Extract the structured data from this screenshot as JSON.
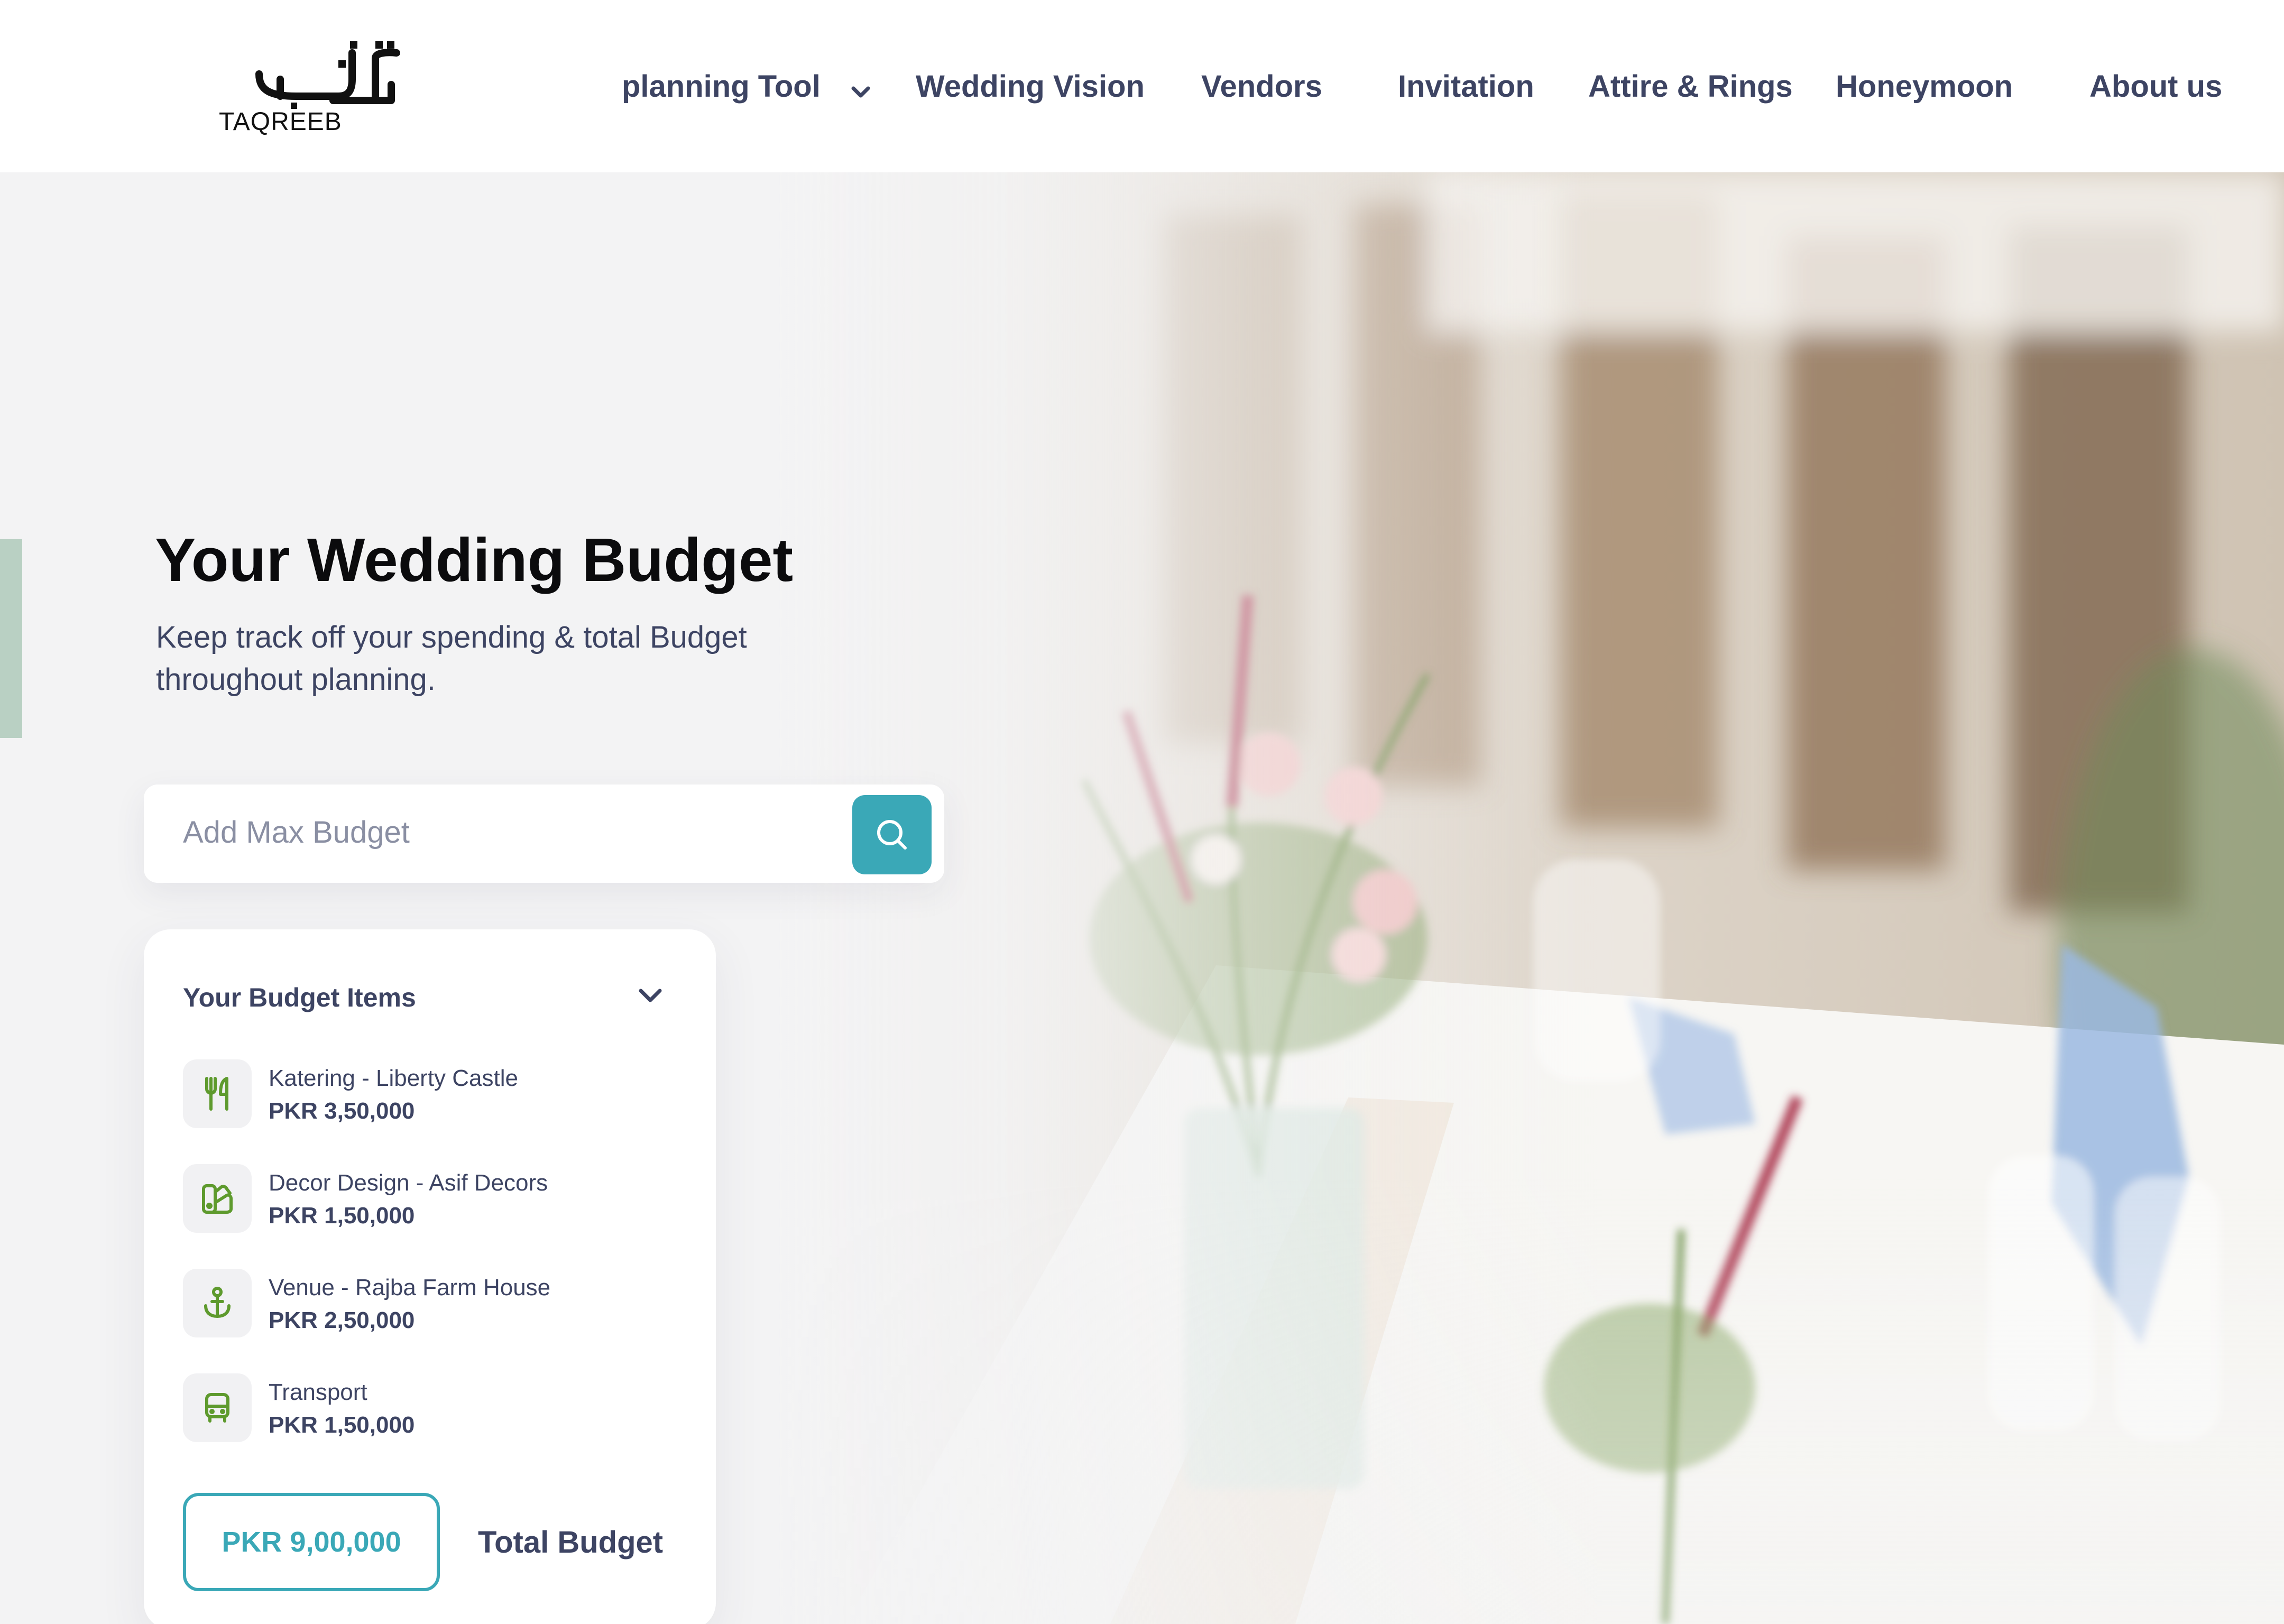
{
  "brand": {
    "name": "TAQREEB"
  },
  "nav": {
    "items": [
      {
        "label": "planning Tool",
        "has_dropdown": true
      },
      {
        "label": "Wedding Vision"
      },
      {
        "label": "Vendors"
      },
      {
        "label": "Invitation"
      },
      {
        "label": "Attire & Rings"
      },
      {
        "label": "Honeymoon"
      },
      {
        "label": "About us"
      }
    ]
  },
  "hero": {
    "title": "Your Wedding Budget",
    "subtitle": "Keep track off your spending & total Budget throughout planning."
  },
  "search": {
    "placeholder": "Add Max Budget",
    "value": "",
    "icon": "search-icon"
  },
  "budget_card": {
    "title": "Your Budget Items",
    "items": [
      {
        "name": "Katering - Liberty Castle",
        "price": "PKR 3,50,000",
        "icon": "cutlery-icon"
      },
      {
        "name": "Decor Design - Asif Decors",
        "price": "PKR 1,50,000",
        "icon": "palette-icon"
      },
      {
        "name": "Venue - Rajba Farm House",
        "price": "PKR 2,50,000",
        "icon": "anchor-icon"
      },
      {
        "name": "Transport",
        "price": "PKR 1,50,000",
        "icon": "bus-icon"
      }
    ],
    "total_value": "PKR 9,00,000",
    "total_label": "Total Budget"
  },
  "colors": {
    "accent": "#3aa8b7",
    "text": "#3d4463",
    "icon_green": "#5e9a2d",
    "side_accent": "#b9d0c3"
  }
}
